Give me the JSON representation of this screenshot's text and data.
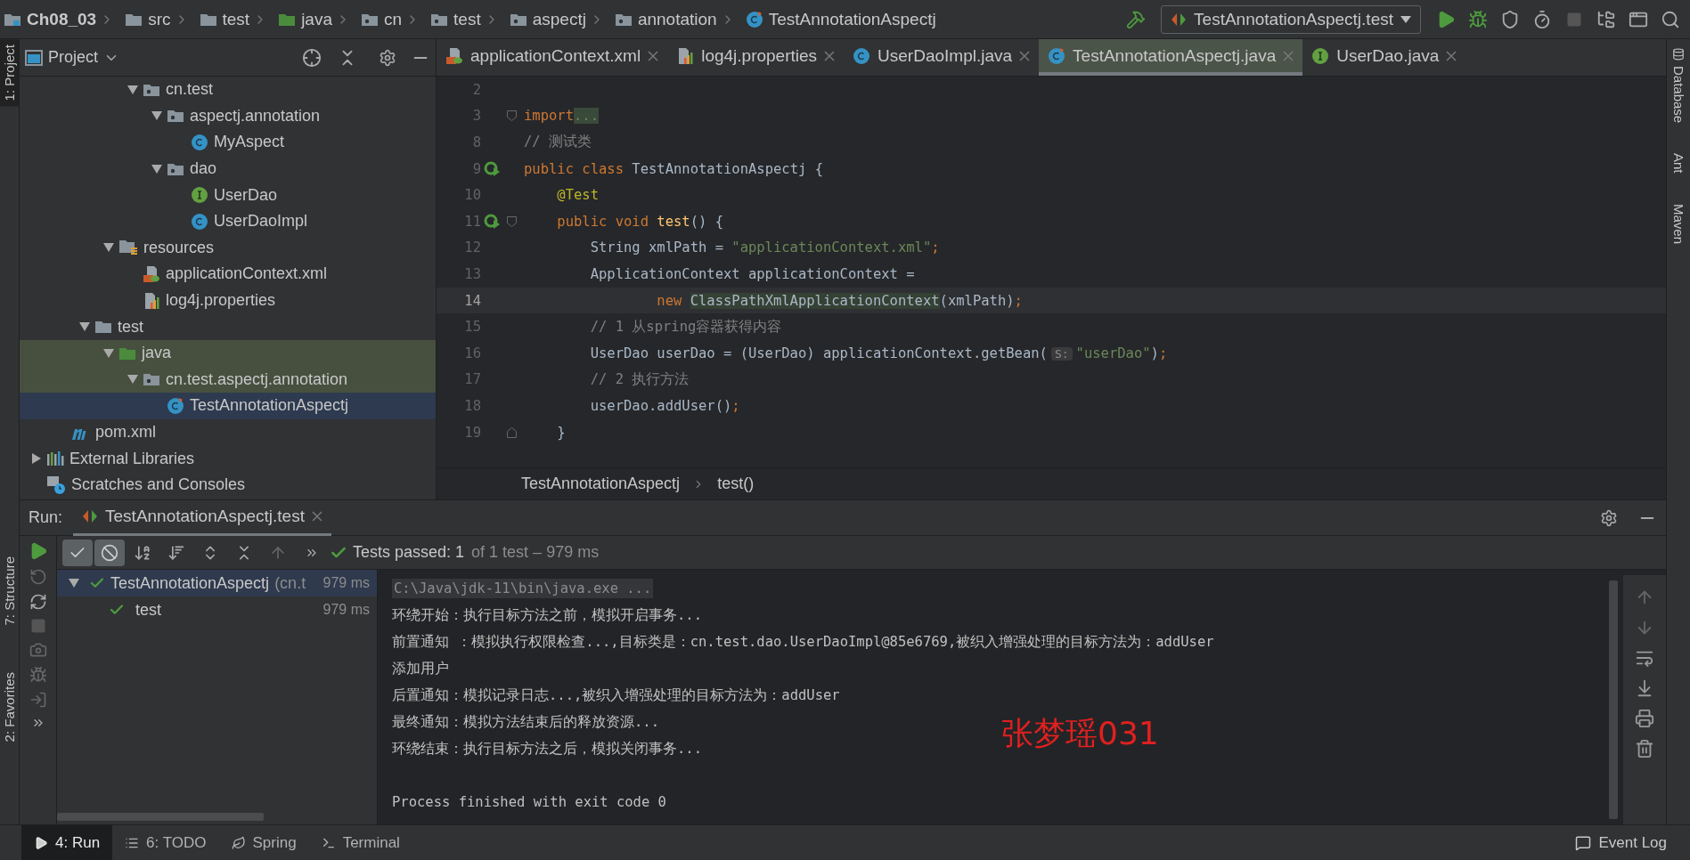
{
  "navbar": {
    "crumbs": [
      {
        "label": "Ch08_03",
        "kind": "module"
      },
      {
        "label": "src",
        "kind": "folder"
      },
      {
        "label": "test",
        "kind": "folder"
      },
      {
        "label": "java",
        "kind": "test-root"
      },
      {
        "label": "cn",
        "kind": "package"
      },
      {
        "label": "test",
        "kind": "package"
      },
      {
        "label": "aspectj",
        "kind": "package"
      },
      {
        "label": "annotation",
        "kind": "package"
      },
      {
        "label": "TestAnnotationAspectj",
        "kind": "test-class"
      }
    ],
    "run_config": "TestAnnotationAspectj.test"
  },
  "left_stripe": [
    {
      "label": "1: Project",
      "selected": true
    },
    {
      "label": "7: Structure",
      "selected": false
    },
    {
      "label": "2: Favorites",
      "selected": false
    }
  ],
  "right_stripe": [
    {
      "label": "Database"
    },
    {
      "label": "Ant"
    },
    {
      "label": "Maven"
    }
  ],
  "project": {
    "title": "Project",
    "tree": [
      {
        "children": [
          {
            "children": [
              {
                "children": [
                  {
                    "children": [
                      {
                        "label": "cn.test",
                        "kind": "package",
                        "expanded": true,
                        "selected": false,
                        "children": [
                          {
                            "label": "aspectj.annotation",
                            "kind": "package",
                            "expanded": true,
                            "selected": false,
                            "children": [
                              {
                                "label": "MyAspect",
                                "kind": "class",
                                "selected": false
                              }
                            ]
                          },
                          {
                            "label": "dao",
                            "kind": "package",
                            "expanded": true,
                            "selected": false,
                            "children": [
                              {
                                "label": "UserDao",
                                "kind": "interface",
                                "selected": false
                              },
                              {
                                "label": "UserDaoImpl",
                                "kind": "class",
                                "selected": false
                              }
                            ]
                          }
                        ]
                      }
                    ]
                  },
                  {
                    "label": "resources",
                    "kind": "resources",
                    "expanded": true,
                    "selected": false,
                    "children": [
                      {
                        "label": "applicationContext.xml",
                        "kind": "xml",
                        "selected": false
                      },
                      {
                        "label": "log4j.properties",
                        "kind": "properties",
                        "selected": false
                      }
                    ]
                  }
                ]
              },
              {
                "label": "test",
                "kind": "folder",
                "expanded": true,
                "selected": false,
                "children": [
                  {
                    "label": "java",
                    "kind": "test-root",
                    "expanded": true,
                    "selected": false,
                    "children": [
                      {
                        "label": "cn.test.aspectj.annotation",
                        "kind": "test-package",
                        "expanded": true,
                        "selected": false,
                        "children": [
                          {
                            "label": "TestAnnotationAspectj",
                            "kind": "test-class",
                            "selected": true
                          }
                        ]
                      }
                    ]
                  }
                ]
              }
            ]
          },
          {
            "label": "pom.xml",
            "kind": "maven",
            "selected": false
          }
        ]
      },
      {
        "label": "External Libraries",
        "kind": "libraries",
        "expanded": false,
        "selected": false
      },
      {
        "label": "Scratches and Consoles",
        "kind": "scratches",
        "selected": false
      }
    ]
  },
  "editor_tabs": [
    {
      "label": "applicationContext.xml",
      "kind": "xml",
      "selected": false
    },
    {
      "label": "log4j.properties",
      "kind": "properties",
      "selected": false
    },
    {
      "label": "UserDaoImpl.java",
      "kind": "class",
      "selected": false
    },
    {
      "label": "TestAnnotationAspectj.java",
      "kind": "test-class",
      "selected": true
    },
    {
      "label": "UserDao.java",
      "kind": "interface",
      "selected": false
    }
  ],
  "code": [
    {
      "number": "2",
      "current": false,
      "kind": "plain"
    },
    {
      "number": "3",
      "current": false,
      "kind": "fold-start",
      "tokens": [
        {
          "text": "import",
          "kind": "keyword"
        },
        {
          "text": "...",
          "kind": "folded"
        }
      ]
    },
    {
      "number": "8",
      "current": false,
      "kind": "plain",
      "tokens": [
        {
          "text": "// 测试类",
          "kind": "comment"
        }
      ]
    },
    {
      "number": "9",
      "current": false,
      "kind": "run",
      "tokens": [
        {
          "text": "public class ",
          "kind": "keyword"
        },
        {
          "text": "TestAnnotationAspectj {",
          "kind": "plain"
        }
      ]
    },
    {
      "number": "10",
      "current": false,
      "kind": "plain",
      "tokens": [
        {
          "text": "    @Test",
          "kind": "annotation"
        }
      ]
    },
    {
      "number": "11",
      "current": false,
      "kind": "run-fold",
      "tokens": [
        {
          "text": "    public void ",
          "kind": "keyword"
        },
        {
          "text": "test",
          "kind": "method"
        },
        {
          "text": "() {",
          "kind": "plain"
        }
      ]
    },
    {
      "number": "12",
      "current": false,
      "kind": "plain",
      "tokens": [
        {
          "text": "        String xmlPath = ",
          "kind": "plain"
        },
        {
          "text": "\"applicationContext.xml\"",
          "kind": "string"
        },
        {
          "text": ";",
          "kind": "keyword"
        }
      ]
    },
    {
      "number": "13",
      "current": false,
      "kind": "plain",
      "tokens": [
        {
          "text": "        ApplicationContext applicationContext =",
          "kind": "plain"
        }
      ]
    },
    {
      "number": "14",
      "current": true,
      "kind": "plain",
      "tokens": [
        {
          "text": "                new ",
          "kind": "keyword"
        },
        {
          "text": "ClassPathXmlApplicationContext",
          "kind": "highlight"
        },
        {
          "text": "(xmlPath)",
          "kind": "plain"
        },
        {
          "text": ";",
          "kind": "keyword"
        }
      ]
    },
    {
      "number": "15",
      "current": false,
      "kind": "plain",
      "tokens": [
        {
          "text": "        // 1 从spring容器获得内容",
          "kind": "comment"
        }
      ]
    },
    {
      "number": "16",
      "current": false,
      "kind": "plain",
      "tokens": [
        {
          "text": "        UserDao userDao = (UserDao) applicationContext.getBean(",
          "kind": "plain"
        },
        {
          "text": "S:",
          "kind": "hint"
        },
        {
          "text": "\"userDao\"",
          "kind": "string"
        },
        {
          "text": ")",
          "kind": "plain"
        },
        {
          "text": ";",
          "kind": "keyword"
        }
      ]
    },
    {
      "number": "17",
      "current": false,
      "kind": "plain",
      "tokens": [
        {
          "text": "        // 2 执行方法",
          "kind": "comment"
        }
      ]
    },
    {
      "number": "18",
      "current": false,
      "kind": "plain",
      "tokens": [
        {
          "text": "        userDao.addUser()",
          "kind": "plain"
        },
        {
          "text": ";",
          "kind": "keyword"
        }
      ]
    },
    {
      "number": "19",
      "current": false,
      "kind": "fold-end",
      "tokens": [
        {
          "text": "    }",
          "kind": "plain"
        }
      ]
    }
  ],
  "editor_breadcrumb": [
    "TestAnnotationAspectj",
    "test()"
  ],
  "run": {
    "label": "Run:",
    "tab": "TestAnnotationAspectj.test",
    "filters": [
      {
        "selected": true
      },
      {
        "selected": true
      }
    ],
    "status_main": "Tests passed: 1",
    "status_rest": "of 1 test – 979 ms",
    "results": [
      {
        "label": "TestAnnotationAspectj",
        "detail": "(cn.t",
        "time": "979 ms",
        "selected": true,
        "expanded": true,
        "children": [
          {
            "label": "test",
            "time": "979 ms",
            "selected": false
          }
        ]
      }
    ],
    "console": [
      {
        "text": "C:\\Java\\jdk-11\\bin\\java.exe ...",
        "kind": "command"
      },
      {
        "text": "环绕开始：执行目标方法之前，模拟开启事务...",
        "kind": "output"
      },
      {
        "text": "前置通知 ：模拟执行权限检查...,目标类是：cn.test.dao.UserDaoImpl@85e6769,被织入增强处理的目标方法为：addUser",
        "kind": "output"
      },
      {
        "text": "添加用户",
        "kind": "output"
      },
      {
        "text": "后置通知：模拟记录日志...,被织入增强处理的目标方法为：addUser",
        "kind": "output"
      },
      {
        "text": "最终通知：模拟方法结束后的释放资源...",
        "kind": "output"
      },
      {
        "text": "环绕结束：执行目标方法之后，模拟关闭事务...",
        "kind": "output"
      },
      {
        "text": "Process finished with exit code 0",
        "kind": "exit"
      }
    ]
  },
  "annotation": "张梦瑶031",
  "bottom_tabs": [
    {
      "label": "4: Run",
      "kind": "run",
      "selected": true
    },
    {
      "label": "6: TODO",
      "kind": "todo",
      "selected": false
    },
    {
      "label": "Spring",
      "kind": "spring",
      "selected": false
    },
    {
      "label": "Terminal",
      "kind": "terminal",
      "selected": false
    }
  ],
  "event_log": "Event Log"
}
